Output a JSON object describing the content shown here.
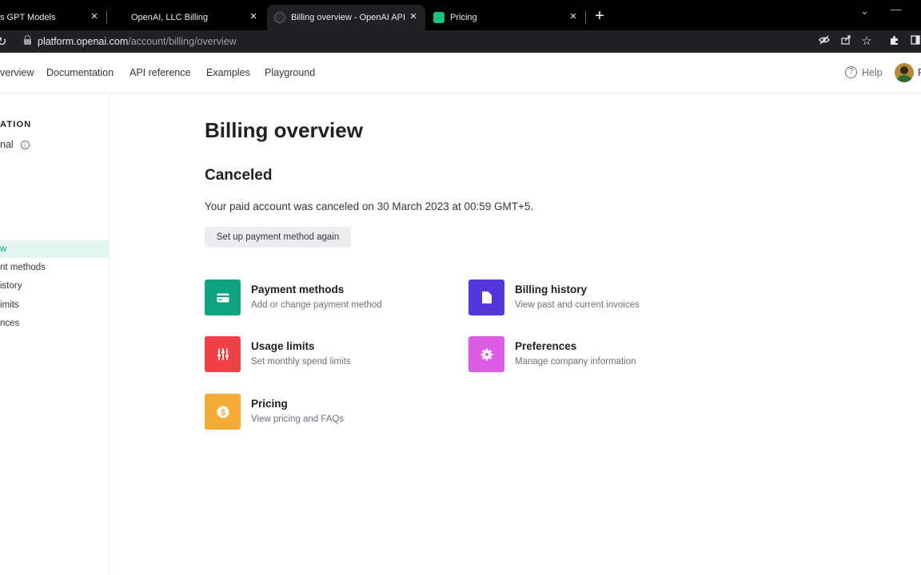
{
  "browser": {
    "tabs": [
      {
        "label": "s GPT Models",
        "favicon_color": ""
      },
      {
        "label": "OpenAI, LLC Billing",
        "favicon_color": ""
      },
      {
        "label": "Billing overview - OpenAI API",
        "favicon_color": "#2d2e33"
      },
      {
        "label": "Pricing",
        "favicon_color": "#19c37d"
      }
    ],
    "url_host": "platform.openai.com",
    "url_path": "/account/billing/overview"
  },
  "topnav": {
    "links": [
      "verview",
      "Documentation",
      "API reference",
      "Examples",
      "Playground"
    ],
    "help_label": "Help",
    "avatar_trail": "F"
  },
  "sidebar": {
    "org_heading": "ATION",
    "org_name": "nal",
    "items": [
      {
        "label": "w",
        "active": true
      },
      {
        "label": "nt methods",
        "active": false
      },
      {
        "label": "istory",
        "active": false
      },
      {
        "label": "imits",
        "active": false
      },
      {
        "label": "nces",
        "active": false
      }
    ]
  },
  "main": {
    "title": "Billing overview",
    "status_title": "Canceled",
    "status_text": "Your paid account was canceled on 30 March 2023 at 00:59 GMT+5.",
    "setup_button": "Set up payment method again",
    "cards": [
      {
        "title": "Payment methods",
        "subtitle": "Add or change payment method",
        "icon": "credit-card-icon",
        "color": "#10a37f"
      },
      {
        "title": "Billing history",
        "subtitle": "View past and current invoices",
        "icon": "document-icon",
        "color": "#5436da"
      },
      {
        "title": "Usage limits",
        "subtitle": "Set monthly spend limits",
        "icon": "sliders-icon",
        "color": "#ef4146"
      },
      {
        "title": "Preferences",
        "subtitle": "Manage company information",
        "icon": "gear-icon",
        "color": "#dd5ce5"
      },
      {
        "title": "Pricing",
        "subtitle": "View pricing and FAQs",
        "icon": "dollar-icon",
        "color": "#f4ac36"
      }
    ]
  }
}
